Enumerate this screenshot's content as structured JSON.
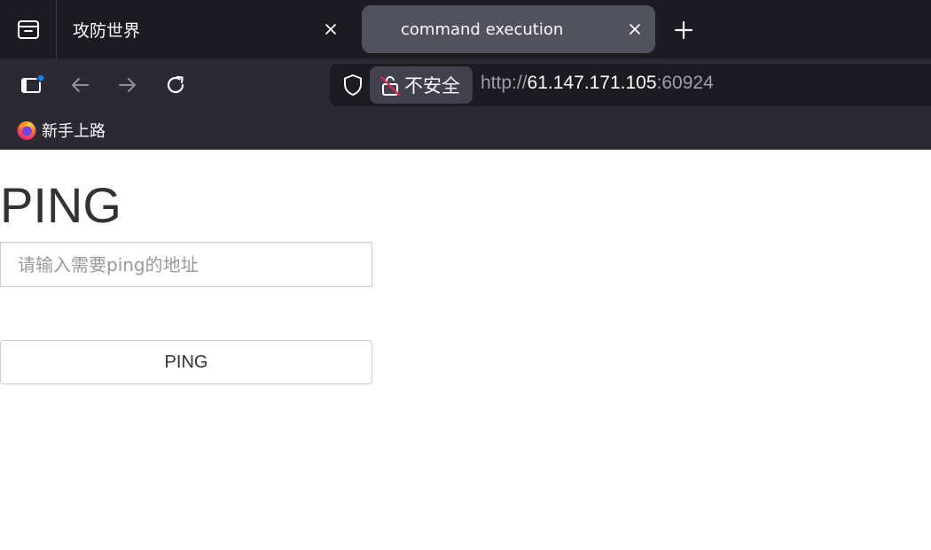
{
  "browser": {
    "tabs": [
      {
        "title": "攻防世界",
        "active": false
      },
      {
        "title": "command execution",
        "active": true
      }
    ],
    "icons": {
      "tab_list": "tab-list-icon",
      "close": "close-icon",
      "new_tab": "plus-icon",
      "sidebar": "sidebar-icon",
      "back": "back-arrow-icon",
      "forward": "forward-arrow-icon",
      "reload": "reload-icon",
      "tracking_protection": "shield-icon",
      "insecure": "insecure-lock-icon",
      "bookmark": "firefox-icon"
    },
    "urlbar": {
      "security_label": "不安全",
      "url_scheme": "http://",
      "url_host": "61.147.171.105",
      "url_port": ":60924"
    },
    "bookmarks": [
      {
        "label": "新手上路"
      }
    ],
    "colors": {
      "tabstrip_bg": "#1c1b22",
      "toolbar_bg": "#2b2a33",
      "active_tab_bg": "#52525e",
      "notification_dot": "#0a84ff"
    }
  },
  "page": {
    "title": "PING",
    "input_placeholder": "请输入需要ping的地址",
    "input_value": "",
    "button_label": "PING"
  }
}
